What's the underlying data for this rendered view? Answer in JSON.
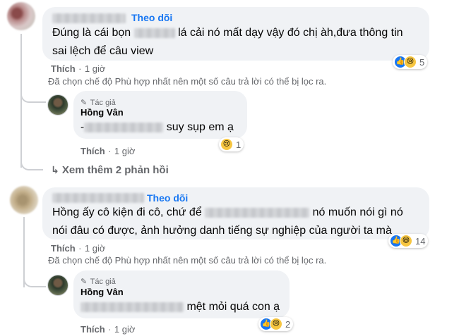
{
  "comments": [
    {
      "follow_label": "Theo dõi",
      "text_before": "Đúng là cái bọn",
      "text_after": "lá cải nó mất dạy vậy đó chị àh,đưa thông tin",
      "text_line2": "sai lệch để câu view",
      "like_label": "Thích",
      "dot": "·",
      "time": "1 giờ",
      "reaction_icons": [
        "like-icon",
        "sad-icon"
      ],
      "reaction_count": "5",
      "filter_notice": "Đã chọn chế độ Phù hợp nhất nên một số câu trả lời có thể bị lọc ra.",
      "reply": {
        "badge": "Tác giả",
        "name": "Hồng Vân",
        "text_prefix": "-",
        "text_after": "suy sụp em ạ",
        "like_label": "Thích",
        "dot": "·",
        "time": "1 giờ",
        "reaction_icons": [
          "sad-icon"
        ],
        "reaction_count": "1"
      },
      "see_more": "Xem thêm 2 phản hồi"
    },
    {
      "follow_label": "Theo dõi",
      "text_before": "Hồng ấy cô kiện đi cô, chứ để",
      "text_after": "nó muốn nói gì nó",
      "text_line2": "nói đâu có được, ảnh hưởng danh tiếng sự nghiệp của người ta mà",
      "like_label": "Thích",
      "dot": "·",
      "time": "1 giờ",
      "reaction_icons": [
        "like-icon",
        "haha-icon"
      ],
      "reaction_count": "14",
      "filter_notice": "Đã chọn chế độ Phù hợp nhất nên một số câu trả lời có thể bị lọc ra.",
      "reply": {
        "badge": "Tác giả",
        "name": "Hồng Vân",
        "text_after": "mệt mỏi quá con ạ",
        "like_label": "Thích",
        "dot": "·",
        "time": "1 giờ",
        "reaction_icons": [
          "like-icon",
          "sad-icon"
        ],
        "reaction_count": "2"
      }
    }
  ]
}
